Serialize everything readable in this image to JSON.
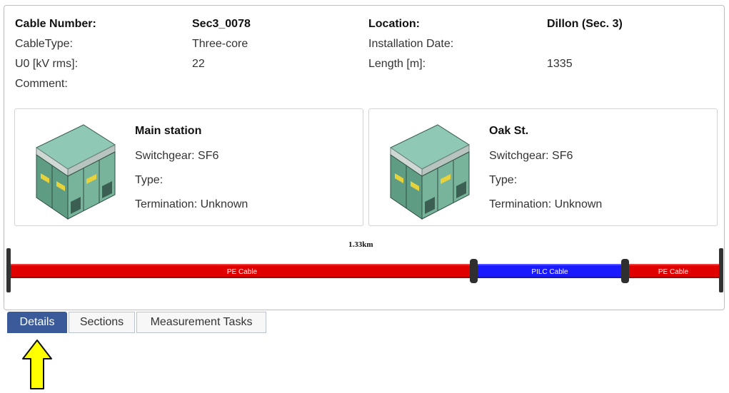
{
  "cable_info": {
    "cable_number_label": "Cable Number:",
    "cable_number_value": "Sec3_0078",
    "location_label": "Location:",
    "location_value": "Dillon (Sec. 3)",
    "cable_type_label": "CableType:",
    "cable_type_value": "Three-core",
    "installation_date_label": "Installation Date:",
    "u0_label": "U0 [kV rms]:",
    "u0_value": "22",
    "length_label": "Length [m]:",
    "length_value": "1335",
    "comment_label": "Comment:"
  },
  "stations": [
    {
      "name": "Main station",
      "switchgear": "Switchgear: SF6",
      "type": "Type:",
      "termination": "Termination: Unknown"
    },
    {
      "name": "Oak St.",
      "switchgear": "Switchgear: SF6",
      "type": "Type:",
      "termination": "Termination: Unknown"
    }
  ],
  "cable_layout": {
    "total_length_label": "1.33km",
    "segments": [
      {
        "label": "PE Cable",
        "color": "#e00000"
      },
      {
        "label": "PILC Cable",
        "color": "#1a1aff"
      },
      {
        "label": "PE Cable",
        "color": "#e00000"
      }
    ]
  },
  "tabs": [
    {
      "label": "Details",
      "active": true
    },
    {
      "label": "Sections",
      "active": false
    },
    {
      "label": "Measurement Tasks",
      "active": false
    }
  ],
  "colors": {
    "active_tab": "#3a5a9a",
    "pe_cable": "#e00000",
    "pilc_cable": "#1a1aff",
    "arrow": "#ffff00"
  },
  "icons": {
    "station": "substation-icon",
    "pointer": "up-arrow-icon"
  }
}
